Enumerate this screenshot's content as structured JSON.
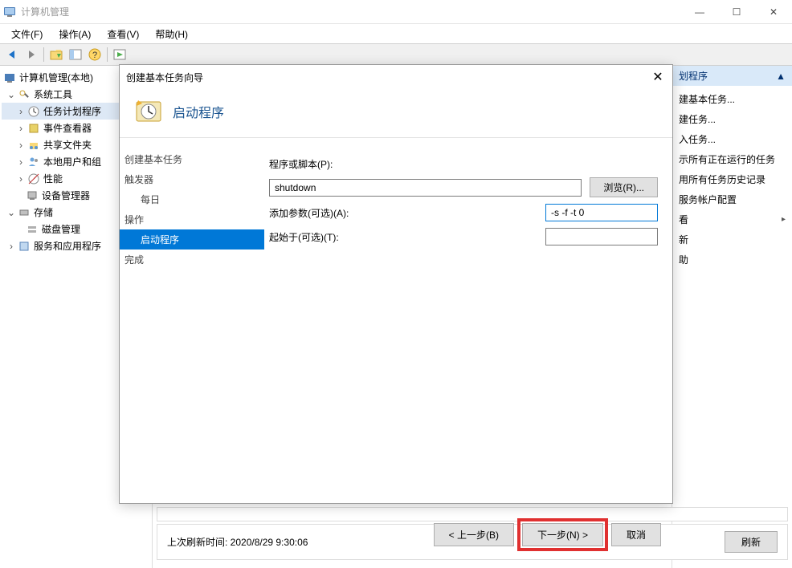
{
  "window": {
    "title": "计算机管理",
    "controls": {
      "minimize": "—",
      "maximize": "☐",
      "close": "✕"
    }
  },
  "menubar": {
    "file": "文件(F)",
    "action": "操作(A)",
    "view": "查看(V)",
    "help": "帮助(H)"
  },
  "tree": {
    "root": "计算机管理(本地)",
    "system_tools": "系统工具",
    "task_scheduler": "任务计划程序",
    "event_viewer": "事件查看器",
    "shared_folders": "共享文件夹",
    "local_users": "本地用户和组",
    "performance": "性能",
    "device_manager": "设备管理器",
    "storage": "存储",
    "disk_management": "磁盘管理",
    "services_apps": "服务和应用程序"
  },
  "actions": {
    "header": "划程序",
    "items": {
      "create_basic": "建基本任务...",
      "create_task": "建任务...",
      "import_task": "入任务...",
      "show_running": "示所有正在运行的任务",
      "history": "用所有任务历史记录",
      "service_account": "服务帐户配置",
      "view": "看",
      "refresh": "新",
      "help": "助"
    },
    "collapse": "▲"
  },
  "dialog": {
    "title": "创建基本任务向导",
    "close": "✕",
    "header_title": "启动程序",
    "steps": {
      "create_basic": "创建基本任务",
      "trigger": "触发器",
      "daily": "每日",
      "operation": "操作",
      "start_program": "启动程序",
      "finish": "完成"
    },
    "form": {
      "program_label": "程序或脚本(P):",
      "program_value": "shutdown",
      "browse": "浏览(R)...",
      "args_label": "添加参数(可选)(A):",
      "args_value": "-s -f -t 0",
      "start_in_label": "起始于(可选)(T):",
      "start_in_value": ""
    },
    "footer": {
      "back": "< 上一步(B)",
      "next": "下一步(N) >",
      "cancel": "取消"
    }
  },
  "status": {
    "upper_text": "",
    "last_refresh": "上次刷新时间: 2020/8/29 9:30:06",
    "refresh": "刷新"
  }
}
